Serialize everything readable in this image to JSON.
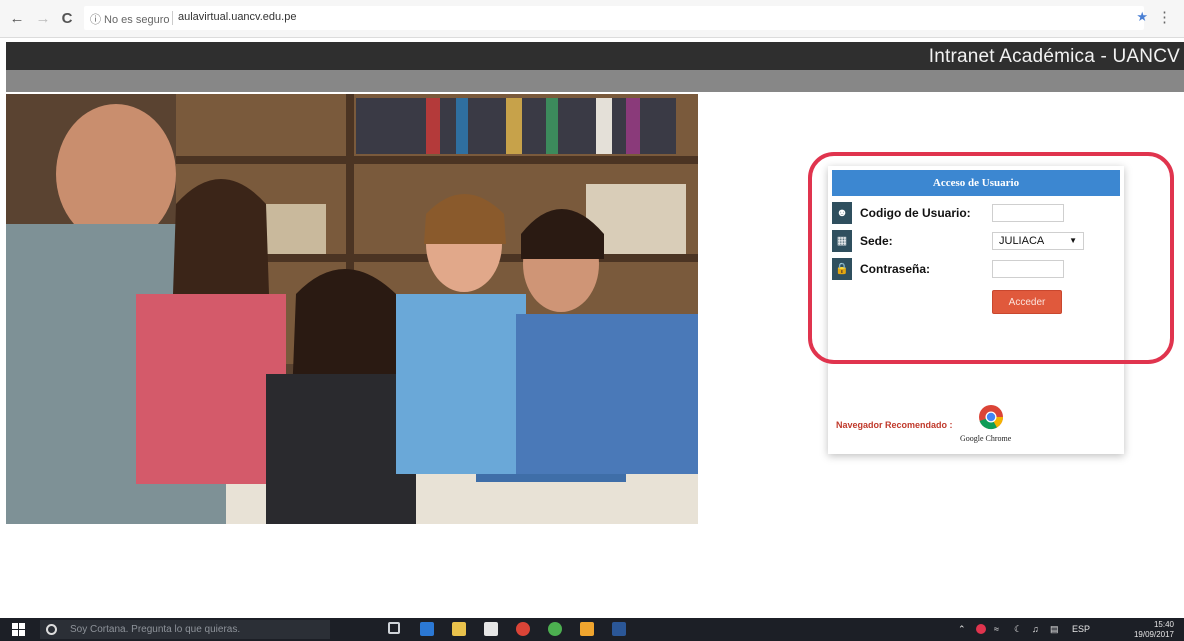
{
  "browser": {
    "back_glyph": "←",
    "forward_glyph": "→",
    "reload_glyph": "C",
    "security_label": "ⓘ No es seguro",
    "url": "aulavirtual.uancv.edu.pe",
    "star_glyph": "★",
    "menu_glyph": "⋮"
  },
  "site": {
    "title": "Intranet Académica - UANCV"
  },
  "hero": {
    "icon": "students-photo"
  },
  "login": {
    "header": "Acceso de Usuario",
    "user_label": "Codigo de Usuario:",
    "user_value": "",
    "sede_label": "Sede:",
    "sede_value": "JULIACA",
    "password_label": "Contraseña:",
    "password_value": "",
    "submit_label": "Acceder",
    "recommended_label": "Navegador Recomendado :",
    "chrome_label": "Google Chrome"
  },
  "colors": {
    "header_bg": "#2f2f2f",
    "login_header_bg": "#3c87d1",
    "submit_bg": "#e0593c",
    "highlight": "#e0344e"
  },
  "taskbar": {
    "search_placeholder": "Soy Cortana. Pregunta lo que quieras.",
    "language": "ESP",
    "time": "15:40",
    "date": "19/09/2017"
  }
}
